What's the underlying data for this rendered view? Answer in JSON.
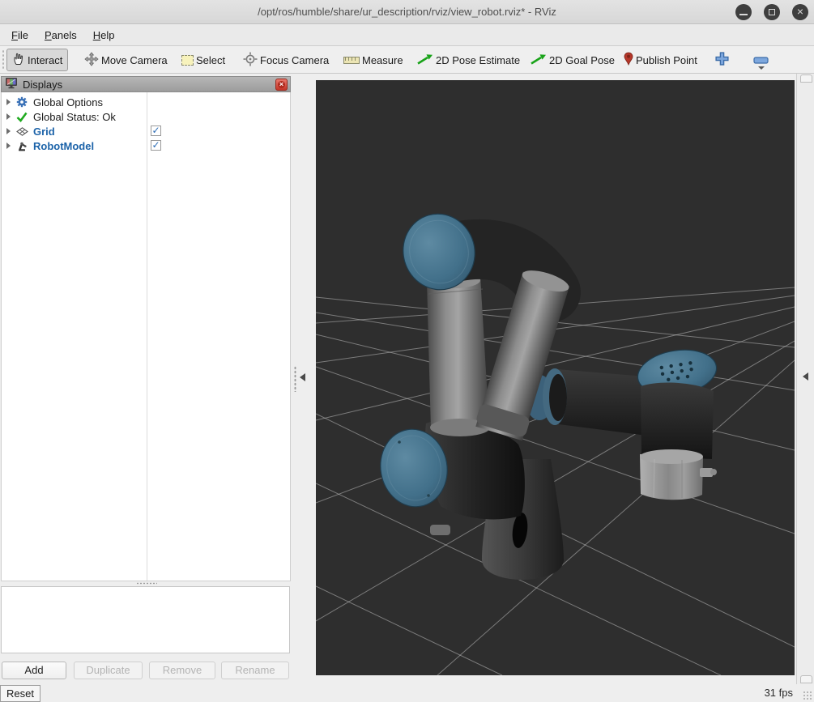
{
  "window": {
    "title": "/opt/ros/humble/share/ur_description/rviz/view_robot.rviz* - RViz"
  },
  "menu": {
    "items": [
      {
        "mnemonic": "F",
        "rest": "ile"
      },
      {
        "mnemonic": "P",
        "rest": "anels"
      },
      {
        "mnemonic": "H",
        "rest": "elp"
      }
    ]
  },
  "toolbar": {
    "tools": [
      {
        "label": "Interact",
        "icon": "hand-icon",
        "active": true
      },
      {
        "label": "Move Camera",
        "icon": "move-arrows-icon",
        "active": false
      },
      {
        "label": "Select",
        "icon": "selection-box-icon",
        "active": false
      },
      {
        "label": "Focus Camera",
        "icon": "focus-target-icon",
        "active": false
      },
      {
        "label": "Measure",
        "icon": "ruler-icon",
        "active": false
      },
      {
        "label": "2D Pose Estimate",
        "icon": "green-arrow-icon",
        "active": false
      },
      {
        "label": "2D Goal Pose",
        "icon": "green-arrow-icon",
        "active": false
      },
      {
        "label": "Publish Point",
        "icon": "map-pin-icon",
        "active": false
      }
    ],
    "add_tool_icon": "plus-icon",
    "remove_tool_icon": "minus-icon"
  },
  "displays_panel": {
    "title": "Displays",
    "rows": [
      {
        "label": "Global Options",
        "icon": "gear-icon",
        "checkbox": null,
        "emphasized": false
      },
      {
        "label": "Global Status: Ok",
        "icon": "check-icon",
        "checkbox": null,
        "emphasized": false
      },
      {
        "label": "Grid",
        "icon": "grid-icon",
        "checkbox": true,
        "emphasized": true
      },
      {
        "label": "RobotModel",
        "icon": "robot-icon",
        "checkbox": true,
        "emphasized": true
      }
    ],
    "buttons": [
      {
        "label": "Add",
        "enabled": true
      },
      {
        "label": "Duplicate",
        "enabled": false
      },
      {
        "label": "Remove",
        "enabled": false
      },
      {
        "label": "Rename",
        "enabled": false
      }
    ]
  },
  "viewport": {
    "fps": "31 fps",
    "background": "#2e2e2e",
    "content_description": "UR robot arm model on perspective grid"
  },
  "statusbar": {
    "reset_label": "Reset"
  },
  "glyphs": {
    "check": "✓",
    "close": "×"
  },
  "colors": {
    "emphasis_blue": "#1c63a9",
    "status_ok_green": "#1faa1f",
    "joint_cap_blue": "#46708a",
    "publish_point_red": "#b5372a",
    "tool_accent_blue": "#7da7dd",
    "viewport_bg": "#2e2e2e"
  }
}
